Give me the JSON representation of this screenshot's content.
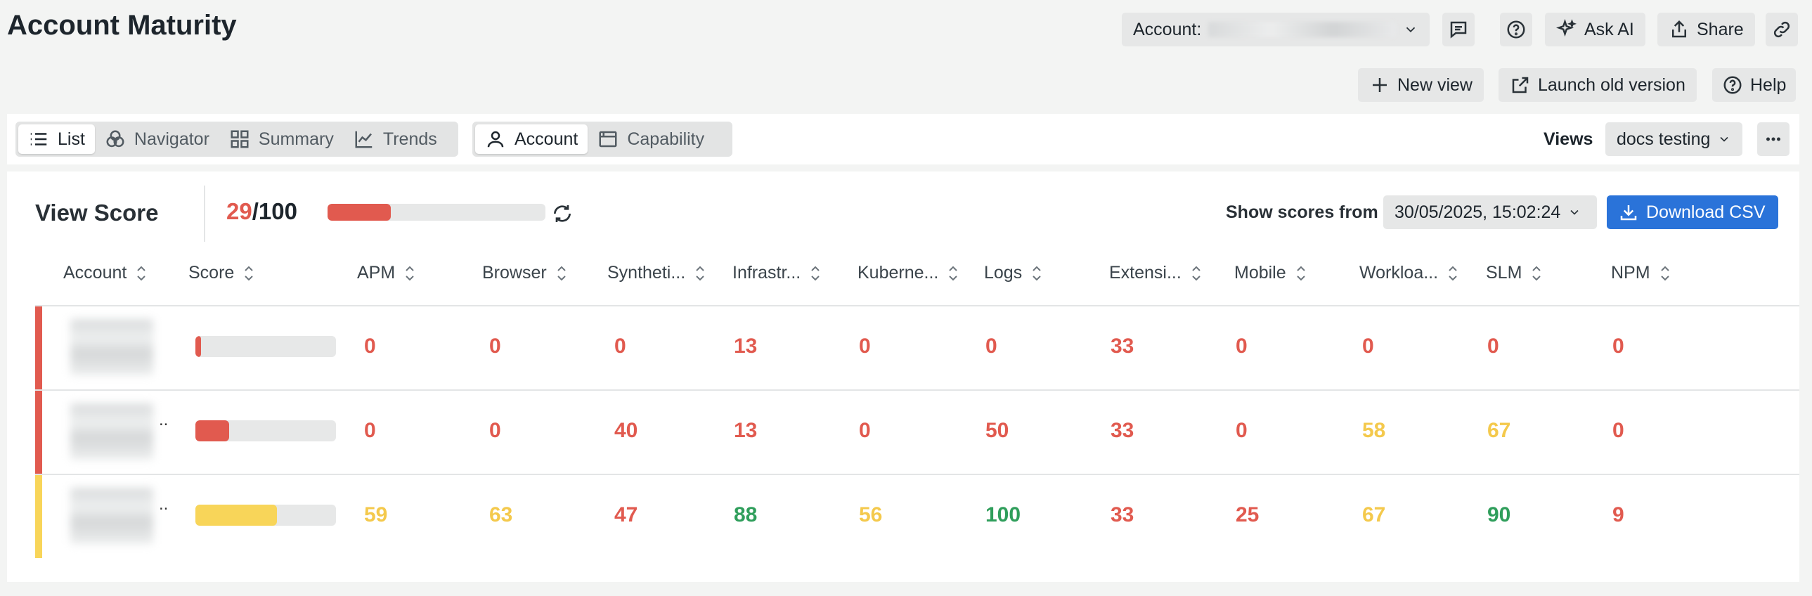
{
  "page_title": "Account Maturity",
  "header": {
    "account_label": "Account:",
    "ask_ai": "Ask AI",
    "share": "Share",
    "new_view": "New view",
    "launch_old": "Launch old version",
    "help": "Help"
  },
  "toolbar": {
    "tabs": [
      "List",
      "Navigator",
      "Summary",
      "Trends"
    ],
    "scope_tabs": [
      "Account",
      "Capability"
    ],
    "views_label": "Views",
    "views_value": "docs testing"
  },
  "score": {
    "label": "View Score",
    "value": "29",
    "total": "/100",
    "progress_fraction": 0.29,
    "show_from_label": "Show scores from",
    "show_from_value": "30/05/2025, 15:02:24",
    "download": "Download CSV"
  },
  "columns": [
    "Account",
    "Score",
    "APM",
    "Browser",
    "Syntheti...",
    "Infrastr...",
    "Kuberne...",
    "Logs",
    "Extensi...",
    "Mobile",
    "Workloa...",
    "SLM",
    "NPM"
  ],
  "rows": [
    {
      "score_fraction": 0.04,
      "status": "red",
      "values": [
        "0",
        "0",
        "0",
        "13",
        "0",
        "0",
        "33",
        "0",
        "0",
        "0",
        "0"
      ],
      "levels": [
        "red",
        "red",
        "red",
        "red",
        "red",
        "red",
        "red",
        "red",
        "red",
        "red",
        "red"
      ],
      "trail": ""
    },
    {
      "score_fraction": 0.24,
      "status": "red",
      "values": [
        "0",
        "0",
        "40",
        "13",
        "0",
        "50",
        "33",
        "0",
        "58",
        "67",
        "0"
      ],
      "levels": [
        "red",
        "red",
        "red",
        "red",
        "red",
        "red",
        "red",
        "red",
        "yellow",
        "yellow",
        "red"
      ],
      "trail": ".."
    },
    {
      "score_fraction": 0.58,
      "status": "yellow",
      "values": [
        "59",
        "63",
        "47",
        "88",
        "56",
        "100",
        "33",
        "25",
        "67",
        "90",
        "9"
      ],
      "levels": [
        "yellow",
        "yellow",
        "red",
        "green",
        "yellow",
        "green",
        "red",
        "red",
        "yellow",
        "green",
        "red"
      ],
      "trail": ".."
    }
  ],
  "colors": {
    "red": "#e15a4f",
    "yellow": "#f8d559",
    "green": "#2f9e5b",
    "accent": "#2a73d9"
  }
}
